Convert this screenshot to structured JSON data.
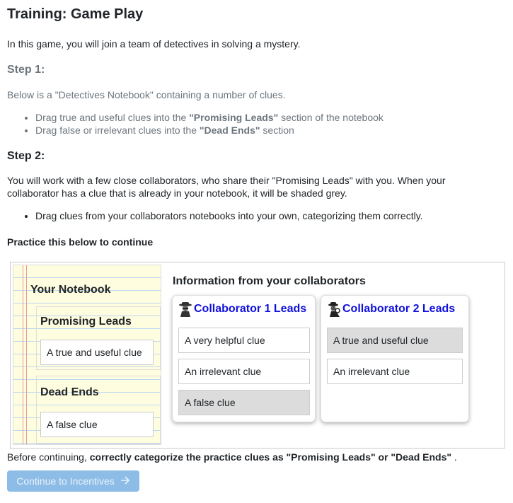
{
  "title": "Training: Game Play",
  "intro": "In this game, you will join a team of detectives in solving a mystery.",
  "step1": {
    "heading": "Step 1:",
    "desc": "Below is a \"Detectives Notebook\" containing a number of clues.",
    "bullets": [
      {
        "pre": "Drag true and useful clues into the ",
        "bold": "\"Promising Leads\"",
        "post": " section of the notebook"
      },
      {
        "pre": "Drag false or irrelevant clues into the ",
        "bold": "\"Dead Ends\"",
        "post": " section"
      }
    ]
  },
  "step2": {
    "heading": "Step 2:",
    "desc": "You will work with a few close collaborators, who share their \"Promising Leads\" with you. When your collaborator has a clue that is already in your notebook, it will be shaded grey.",
    "bullet": "Drag clues from your collaborators notebooks into your own, categorizing them correctly."
  },
  "practice_label": "Practice this below to continue",
  "notebook": {
    "title": "Your Notebook",
    "promising": {
      "title": "Promising Leads",
      "clues": [
        "A true and useful clue"
      ]
    },
    "dead": {
      "title": "Dead Ends",
      "clues": [
        "A false clue"
      ]
    }
  },
  "collaborators_heading": "Information from your collaborators",
  "collaborators": [
    {
      "label": "Collaborator 1 Leads",
      "clues": [
        {
          "text": "A very helpful clue",
          "shaded": false
        },
        {
          "text": "An irrelevant clue",
          "shaded": false
        },
        {
          "text": "A false clue",
          "shaded": true
        }
      ]
    },
    {
      "label": "Collaborator 2 Leads",
      "clues": [
        {
          "text": "A true and useful clue",
          "shaded": true
        },
        {
          "text": "An irrelevant clue",
          "shaded": false
        }
      ]
    }
  ],
  "before": {
    "pre": "Before continuing, ",
    "bold": "correctly categorize the practice clues as \"Promising Leads\" or \"Dead Ends\"",
    "post": " ."
  },
  "continue_button": "Continue to Incentives",
  "colors": {
    "link_blue": "#1010dd",
    "button_bg": "#8dbde6",
    "shaded_clue": "#dcdcdc",
    "notebook_paper": "#fffde0"
  },
  "icons": {
    "collaborator_1": "detective-icon",
    "collaborator_2": "detective-icon",
    "continue": "arrow-right-icon"
  }
}
